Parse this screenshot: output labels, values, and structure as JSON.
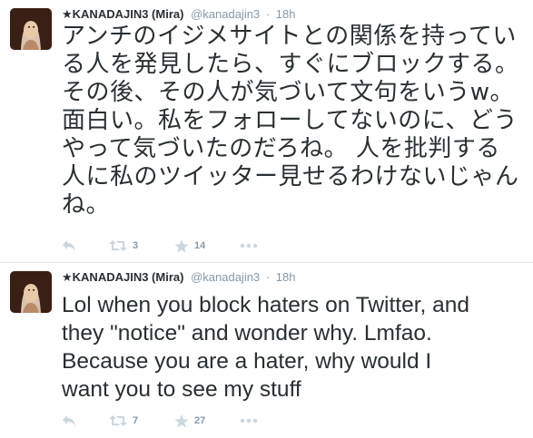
{
  "tweets": [
    {
      "display_name": "★KANADAJIN3 (Mira)",
      "handle": "@kanadajin3",
      "separator": "·",
      "time": "18h",
      "lines": [
        "アンチのイジメサイトとの関係を持ってい",
        "る人を発見したら、すぐにブロックする。",
        "その後、その人が気づいて文句をいうw。",
        "面白い。私をフォローしてないのに、どう",
        "やって気づいたのだろね。 人を批判する",
        "人に私のツイッター見せるわけないじゃん",
        "ね。"
      ],
      "retweet_count": "3",
      "favorite_count": "14"
    },
    {
      "display_name": "★KANADAJIN3 (Mira)",
      "handle": "@kanadajin3",
      "separator": "·",
      "time": "18h",
      "lines": [
        "Lol when you block haters on Twitter, and",
        "they \"notice\" and wonder why. Lmfao.",
        "Because you are a hater, why would I",
        "want you to see my stuff"
      ],
      "retweet_count": "7",
      "favorite_count": "27"
    }
  ],
  "icons": {
    "reply": "reply-icon",
    "retweet": "retweet-icon",
    "favorite": "star-icon",
    "more": "more-icon"
  },
  "colors": {
    "text": "#292f33",
    "muted": "#8899a6",
    "icon": "#ccd6dd",
    "divider": "#e1e8ed"
  }
}
